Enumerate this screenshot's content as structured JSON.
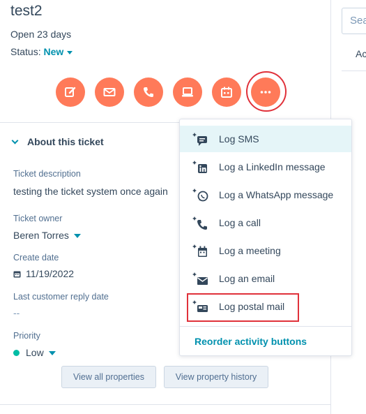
{
  "ticket": {
    "title": "test2",
    "open_days": "Open 23 days",
    "status_label": "Status:",
    "status_value": "New"
  },
  "action_buttons": [
    {
      "name": "note",
      "icon": "pencil-icon"
    },
    {
      "name": "email",
      "icon": "envelope-icon"
    },
    {
      "name": "call",
      "icon": "phone-icon"
    },
    {
      "name": "task",
      "icon": "laptop-icon"
    },
    {
      "name": "meeting",
      "icon": "calendar-icon"
    },
    {
      "name": "more",
      "icon": "ellipsis-icon"
    }
  ],
  "about": {
    "header": "About this ticket",
    "fields": {
      "description_label": "Ticket description",
      "description_value": "testing the ticket system once again",
      "owner_label": "Ticket owner",
      "owner_value": "Beren Torres",
      "create_label": "Create date",
      "create_value": "11/19/2022",
      "last_reply_label": "Last customer reply date",
      "last_reply_value": "--",
      "priority_label": "Priority",
      "priority_value": "Low"
    },
    "view_all": "View all properties",
    "view_history": "View property history"
  },
  "right_panel": {
    "search_placeholder": "Sea",
    "partial_text": "Ac"
  },
  "dropdown": {
    "items": [
      {
        "label": "Log SMS",
        "icon": "sms-icon",
        "highlighted": true
      },
      {
        "label": "Log a LinkedIn message",
        "icon": "linkedin-icon",
        "highlighted": false
      },
      {
        "label": "Log a WhatsApp message",
        "icon": "whatsapp-icon",
        "highlighted": false
      },
      {
        "label": "Log a call",
        "icon": "phone-icon",
        "highlighted": false
      },
      {
        "label": "Log a meeting",
        "icon": "calendar-icon",
        "highlighted": false
      },
      {
        "label": "Log an email",
        "icon": "envelope-icon",
        "highlighted": false
      },
      {
        "label": "Log postal mail",
        "icon": "postal-mail-icon",
        "highlighted": false
      }
    ],
    "reorder_label": "Reorder activity buttons"
  },
  "colors": {
    "accent_orange": "#ff7a59",
    "teal": "#0091ae",
    "callout_red": "#e0313a",
    "priority_dot": "#00bda5",
    "hover_bg": "#e5f5f8"
  }
}
